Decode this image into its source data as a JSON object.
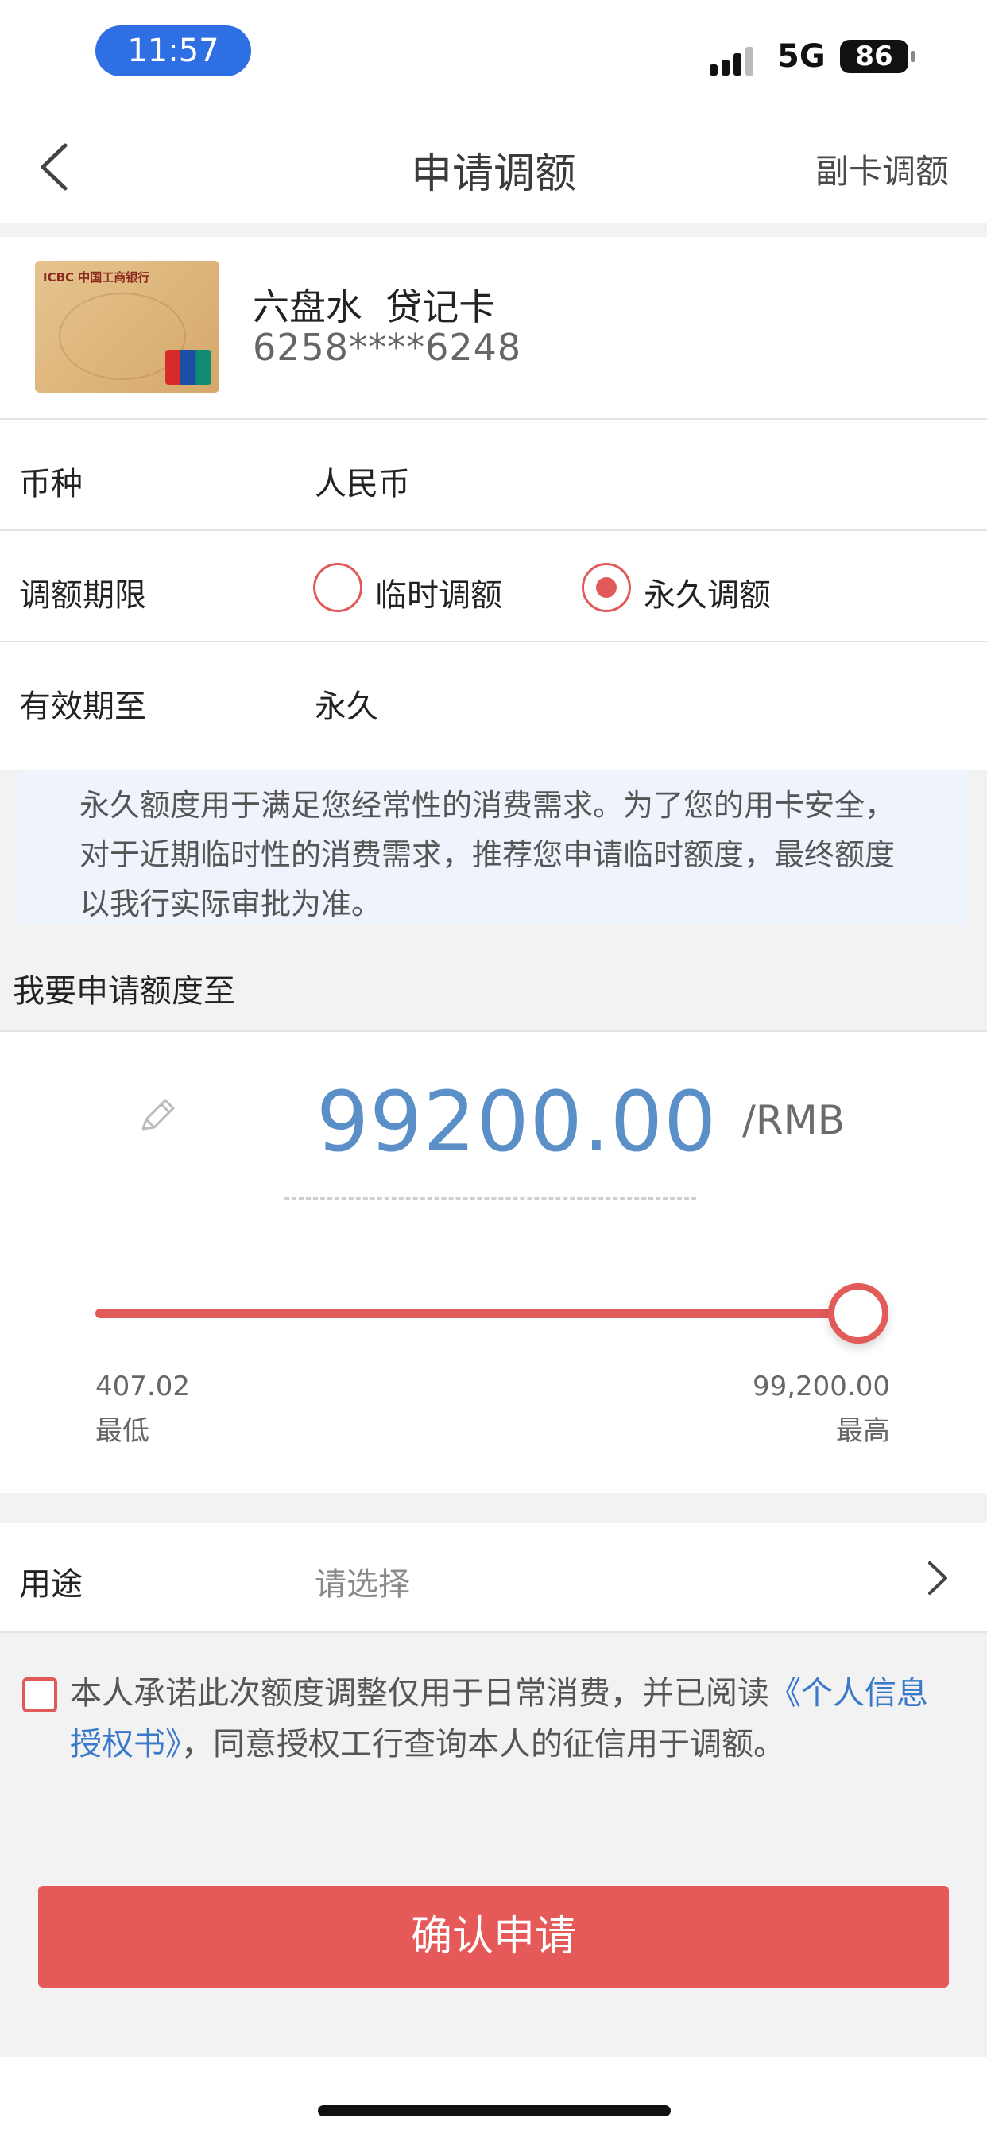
{
  "status_bar": {
    "time": "11:57",
    "network": "5G",
    "battery": "86"
  },
  "nav": {
    "title": "申请调额",
    "right_label": "副卡调额"
  },
  "card": {
    "bank_text": "ICBC 中国工商银行",
    "name": "六盘水  贷记卡",
    "number": "6258****6248"
  },
  "form": {
    "currency": {
      "label": "币种",
      "value": "人民币"
    },
    "term": {
      "label": "调额期限",
      "options": [
        {
          "label": "临时调额",
          "selected": false
        },
        {
          "label": "永久调额",
          "selected": true
        }
      ]
    },
    "valid_until": {
      "label": "有效期至",
      "value": "永久"
    }
  },
  "notice": "永久额度用于满足您经常性的消费需求。为了您的用卡安全，对于近期临时性的消费需求，推荐您申请临时额度，最终额度以我行实际审批为准。",
  "amount_section": {
    "heading": "我要申请额度至",
    "amount": "99200.00",
    "unit": "/RMB",
    "slider_fraction": 1.0,
    "min_value": "407.02",
    "min_label": "最低",
    "max_value": "99,200.00",
    "max_label": "最高"
  },
  "purpose": {
    "label": "用途",
    "placeholder": "请选择"
  },
  "agreement": {
    "text_before": "本人承诺此次额度调整仅用于日常消费，并已阅读",
    "link": "《个人信息授权书》",
    "text_after": "，同意授权工行查询本人的征信用于调额。"
  },
  "confirm_button": "确认申请",
  "colors": {
    "accent": "#e55a58",
    "amount_blue": "#5b8fc8",
    "link_blue": "#3a78c9"
  }
}
